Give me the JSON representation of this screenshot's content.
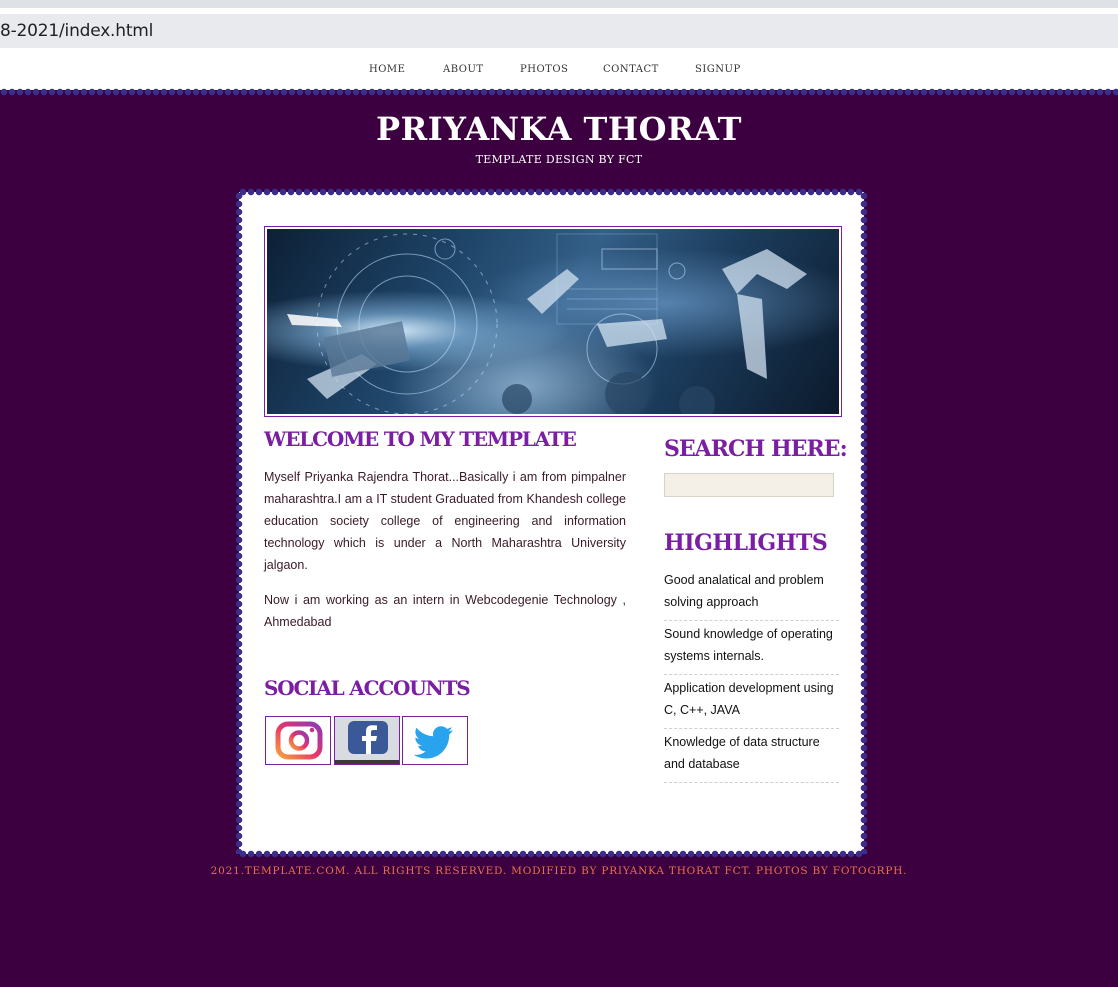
{
  "browser": {
    "url": "8-2021/index.html"
  },
  "nav": {
    "items": [
      {
        "label": "HOME"
      },
      {
        "label": "ABOUT"
      },
      {
        "label": "PHOTOS"
      },
      {
        "label": "CONTACT"
      },
      {
        "label": "SIGNUP"
      }
    ]
  },
  "header": {
    "title": "PRIYANKA THORAT",
    "subtitle": "TEMPLATE DESIGN BY FCT"
  },
  "main": {
    "welcome_heading": "WELCOME TO MY TEMPLATE",
    "paragraphs": [
      "Myself Priyanka Rajendra Thorat...Basically i am from pimpalner maharashtra.I am a IT student Graduated from Khandesh college education society college of engineering and information technology which is under a North Maharashtra University jalgaon.",
      "Now i am working as an intern in Webcodegenie Technology , Ahmedabad"
    ],
    "social_heading": "SOCIAL ACCOUNTS",
    "social": [
      {
        "name": "instagram-icon"
      },
      {
        "name": "facebook-icon"
      },
      {
        "name": "twitter-icon"
      }
    ]
  },
  "sidebar": {
    "search_heading": "SEARCH HERE:",
    "search_value": "",
    "highlights_heading": "HIGHLIGHTS",
    "highlights": [
      "Good analatical and problem solving approach",
      "Sound knowledge of operating systems internals.",
      "Application development using C, C++, JAVA",
      "Knowledge of data structure and database"
    ]
  },
  "footer": {
    "text": "2021.TEMPLATE.COM. ALL RIGHTS RESERVED. MODIFIED BY PRIYANKA THORAT FCT. PHOTOS BY FOTOGRPH."
  },
  "colors": {
    "background": "#3c0040",
    "accent": "#7a1fa2",
    "footer_text": "#e8734a",
    "scallop": "#3a2e8a"
  }
}
